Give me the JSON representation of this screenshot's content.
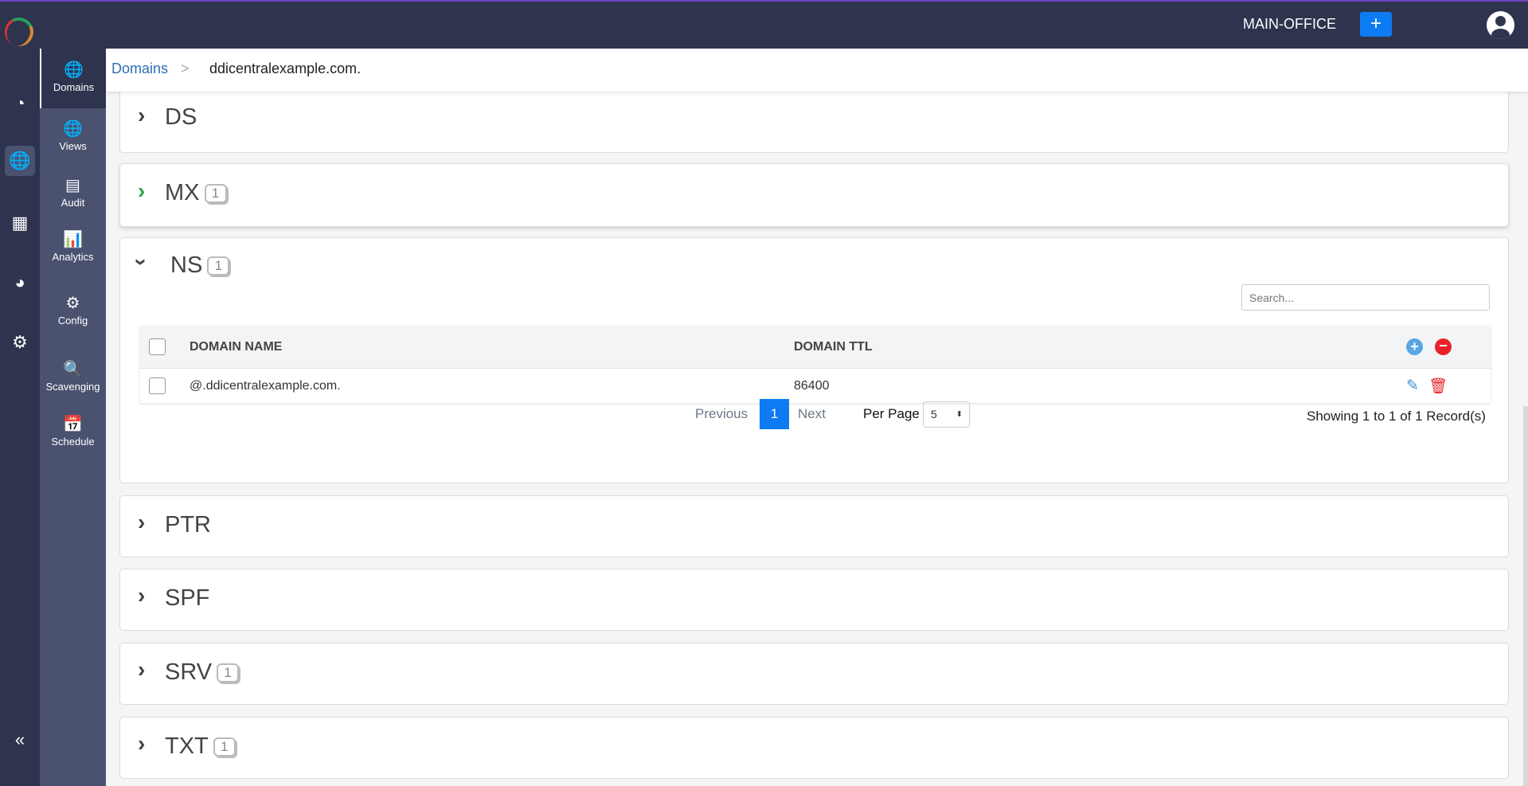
{
  "header": {
    "office": "MAIN-OFFICE",
    "add_label": "+"
  },
  "rail": [
    "dashboard-icon",
    "dns-icon",
    "ipam-icon",
    "reports-icon",
    "settings-icon"
  ],
  "collapse_label": "«",
  "sidebar": [
    {
      "label": "Domains",
      "icon": "🌐"
    },
    {
      "label": "Views",
      "icon": "🌐"
    },
    {
      "label": "Audit",
      "icon": "▤"
    },
    {
      "label": "Analytics",
      "icon": "📊"
    },
    {
      "label": "Config",
      "icon": "⚙"
    },
    {
      "label": "Scavenging",
      "icon": "🔍"
    },
    {
      "label": "Schedule",
      "icon": "📅"
    }
  ],
  "breadcrumb": {
    "root": "Domains",
    "sep": ">",
    "current": "ddicentralexample.com."
  },
  "sections": [
    {
      "title": "DS",
      "count": null
    },
    {
      "title": "MX",
      "count": "1"
    },
    {
      "title": "NS",
      "count": "1"
    },
    {
      "title": "PTR",
      "count": null
    },
    {
      "title": "SPF",
      "count": null
    },
    {
      "title": "SRV",
      "count": "1"
    },
    {
      "title": "TXT",
      "count": "1"
    }
  ],
  "ns_table": {
    "search_placeholder": "Search...",
    "columns": [
      "DOMAIN NAME",
      "DOMAIN TTL"
    ],
    "rows": [
      {
        "name": "@.ddicentralexample.com.",
        "ttl": "86400"
      }
    ],
    "pagination": {
      "previous": "Previous",
      "page": "1",
      "next": "Next",
      "per_page_label": "Per Page",
      "per_page": "5",
      "showing": "Showing 1 to 1 of 1 Record(s)"
    }
  }
}
